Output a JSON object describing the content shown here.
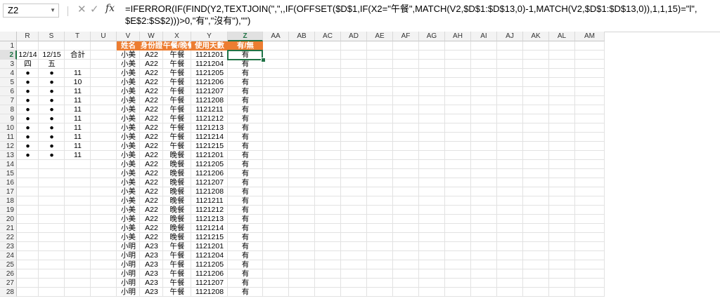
{
  "formula_bar": {
    "name_box": "Z2",
    "cancel_glyph": "✕",
    "confirm_glyph": "✓",
    "fx_label": "fx",
    "formula_text": "=IFERROR(IF(FIND(Y2,TEXTJOIN(\",\",,IF(OFFSET($D$1,IF(X2=\"午餐\",MATCH(V2,$D$1:$D$13,0)-1,MATCH(V2,$D$1:$D$13,0)),1,1,15)=\"l\",\n$E$2:$S$2)))>0,\"有\",\"沒有\"),\"\")"
  },
  "columns": [
    "R",
    "S",
    "T",
    "U",
    "V",
    "W",
    "X",
    "Y",
    "Z",
    "AA",
    "AB",
    "AC",
    "AD",
    "AE",
    "AF",
    "AG",
    "AH",
    "AI",
    "AJ",
    "AK",
    "AL",
    "AM"
  ],
  "selected_column": "Z",
  "selected_row": 2,
  "rows": [
    1,
    2,
    3,
    4,
    5,
    6,
    7,
    8,
    9,
    10,
    11,
    12,
    13,
    14,
    15,
    16,
    17,
    18,
    19,
    20,
    21,
    22,
    23,
    24,
    25,
    26,
    27,
    28
  ],
  "table_headers": [
    "姓名",
    "身份證",
    "午餐/晚餐",
    "使用天數",
    "有/無"
  ],
  "left_block": {
    "row2": [
      "12/14",
      "12/15",
      "合計"
    ],
    "row3": [
      "四",
      "五",
      ""
    ],
    "rows": [
      [
        "●",
        "●",
        "11"
      ],
      [
        "●",
        "●",
        "10"
      ],
      [
        "●",
        "●",
        "11"
      ],
      [
        "●",
        "●",
        "11"
      ],
      [
        "●",
        "●",
        "11"
      ],
      [
        "●",
        "●",
        "11"
      ],
      [
        "●",
        "●",
        "11"
      ],
      [
        "●",
        "●",
        "11"
      ],
      [
        "●",
        "●",
        "11"
      ],
      [
        "●",
        "●",
        "11"
      ]
    ]
  },
  "table_rows": [
    [
      "小美",
      "A22",
      "午餐",
      "1121201",
      "有"
    ],
    [
      "小美",
      "A22",
      "午餐",
      "1121204",
      "有"
    ],
    [
      "小美",
      "A22",
      "午餐",
      "1121205",
      "有"
    ],
    [
      "小美",
      "A22",
      "午餐",
      "1121206",
      "有"
    ],
    [
      "小美",
      "A22",
      "午餐",
      "1121207",
      "有"
    ],
    [
      "小美",
      "A22",
      "午餐",
      "1121208",
      "有"
    ],
    [
      "小美",
      "A22",
      "午餐",
      "1121211",
      "有"
    ],
    [
      "小美",
      "A22",
      "午餐",
      "1121212",
      "有"
    ],
    [
      "小美",
      "A22",
      "午餐",
      "1121213",
      "有"
    ],
    [
      "小美",
      "A22",
      "午餐",
      "1121214",
      "有"
    ],
    [
      "小美",
      "A22",
      "午餐",
      "1121215",
      "有"
    ],
    [
      "小美",
      "A22",
      "晚餐",
      "1121201",
      "有"
    ],
    [
      "小美",
      "A22",
      "晚餐",
      "1121205",
      "有"
    ],
    [
      "小美",
      "A22",
      "晚餐",
      "1121206",
      "有"
    ],
    [
      "小美",
      "A22",
      "晚餐",
      "1121207",
      "有"
    ],
    [
      "小美",
      "A22",
      "晚餐",
      "1121208",
      "有"
    ],
    [
      "小美",
      "A22",
      "晚餐",
      "1121211",
      "有"
    ],
    [
      "小美",
      "A22",
      "晚餐",
      "1121212",
      "有"
    ],
    [
      "小美",
      "A22",
      "晚餐",
      "1121213",
      "有"
    ],
    [
      "小美",
      "A22",
      "晚餐",
      "1121214",
      "有"
    ],
    [
      "小美",
      "A22",
      "晚餐",
      "1121215",
      "有"
    ],
    [
      "小明",
      "A23",
      "午餐",
      "1121201",
      "有"
    ],
    [
      "小明",
      "A23",
      "午餐",
      "1121204",
      "有"
    ],
    [
      "小明",
      "A23",
      "午餐",
      "1121205",
      "有"
    ],
    [
      "小明",
      "A23",
      "午餐",
      "1121206",
      "有"
    ],
    [
      "小明",
      "A23",
      "午餐",
      "1121207",
      "有"
    ],
    [
      "小明",
      "A23",
      "午餐",
      "1121208",
      "有"
    ]
  ],
  "colors": {
    "header_fill": "#ed7d31",
    "selection": "#217346"
  }
}
